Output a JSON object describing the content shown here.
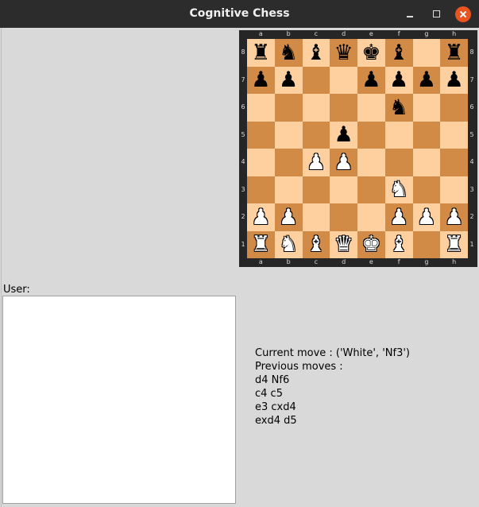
{
  "window": {
    "title": "Cognitive Chess"
  },
  "board": {
    "files": [
      "a",
      "b",
      "c",
      "d",
      "e",
      "f",
      "g",
      "h"
    ],
    "ranks": [
      "8",
      "7",
      "6",
      "5",
      "4",
      "3",
      "2",
      "1"
    ],
    "position": [
      [
        "bR",
        "bN",
        "bB",
        "bQ",
        "bK",
        "bB",
        "",
        "bR"
      ],
      [
        "bP",
        "bP",
        "",
        "",
        "bP",
        "bP",
        "bP",
        "bP"
      ],
      [
        "",
        "",
        "",
        "",
        "",
        "bN",
        "",
        ""
      ],
      [
        "",
        "",
        "",
        "bP",
        "",
        "",
        "",
        ""
      ],
      [
        "",
        "",
        "wP",
        "wP",
        "",
        "",
        "",
        ""
      ],
      [
        "",
        "",
        "",
        "",
        "",
        "wN",
        "",
        ""
      ],
      [
        "wP",
        "wP",
        "",
        "",
        "",
        "wP",
        "wP",
        "wP"
      ],
      [
        "wR",
        "wN",
        "wB",
        "wQ",
        "wK",
        "wB",
        "",
        "wR"
      ]
    ],
    "light_color": "#fecf9f",
    "dark_color": "#d18b47"
  },
  "user": {
    "label": "User:",
    "value": ""
  },
  "moves": {
    "current": "Current move : ('White', 'Nf3')",
    "previous_label": "Previous moves :",
    "list": [
      "d4 Nf6",
      "c4 c5",
      "e3 cxd4",
      "exd4 d5"
    ]
  }
}
